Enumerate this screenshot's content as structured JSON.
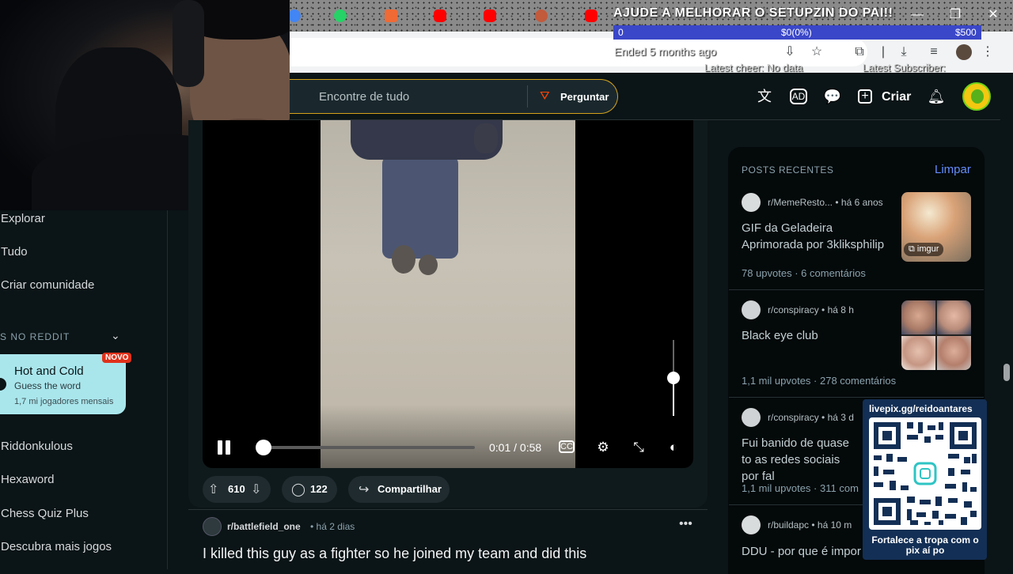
{
  "browser": {
    "tab_icons": [
      "chrome-icon",
      "whatsapp-icon",
      "bookmark-icon",
      "youtube-icon",
      "youtube-icon",
      "image-icon",
      "youtube-icon",
      "close-icon"
    ],
    "toolbar_icons": [
      "install-icon",
      "star-icon",
      "extensions-icon",
      "downloads-icon",
      "playlist-icon",
      "profile-icon",
      "more-icon"
    ],
    "window_controls": [
      "minimize-icon",
      "maximize-icon",
      "close-icon"
    ]
  },
  "overlay": {
    "title": "AJUDE A MELHORAR O SETUPZIN DO PAI!!",
    "goal_start": "0",
    "goal_current": "$0(0%)",
    "goal_target": "$500",
    "ended": "Ended 5 months ago",
    "latest_cheer": "Latest cheer: No data",
    "latest_subscriber": "Latest Subscriber:"
  },
  "header": {
    "search_placeholder": "Encontre de tudo",
    "ask_label": "Perguntar",
    "create_label": "Criar"
  },
  "sidebar": {
    "items": [
      "Explorar",
      "Tudo",
      "Criar comunidade"
    ],
    "section_heading": "S NO REDDIT",
    "game_card": {
      "title": "Hot and Cold",
      "subtitle": "Guess the word",
      "users": "1,7 mi jogadores mensais",
      "badge": "NOVO"
    },
    "games": [
      "Riddonkulous",
      "Hexaword",
      "Chess Quiz Plus",
      "Descubra mais jogos"
    ]
  },
  "video": {
    "time": "0:01 / 0:58",
    "progress": 0.02,
    "volume": 0.5
  },
  "post_actions": {
    "votes": "610",
    "comments": "122",
    "share_label": "Compartilhar"
  },
  "next_post": {
    "subreddit": "r/battlefield_one",
    "time": "há 2 dias",
    "title": "I killed this guy as a fighter so he joined my team and did this"
  },
  "recent_posts": {
    "heading": "POSTS RECENTES",
    "clear_label": "Limpar",
    "thumb_badge": "imgur",
    "items": [
      {
        "subreddit": "r/MemeResto...",
        "time": "há 6 anos",
        "title": "GIF da Geladeira Aprimorada por 3kliksphilip",
        "upvotes": "78 upvotes",
        "comments": "6 comentários"
      },
      {
        "subreddit": "r/conspiracy",
        "time": "há 8 h",
        "title": "Black eye club",
        "upvotes": "1,1 mil upvotes",
        "comments": "278 comentários"
      },
      {
        "subreddit": "r/conspiracy",
        "time": "há 3 d",
        "title": "Fui banido de quase to as redes sociais por fal",
        "upvotes": "1,1 mil upvotes",
        "comments": "311 com"
      },
      {
        "subreddit": "r/buildapc",
        "time": "há 10 m",
        "title": "DDU - por que é impor",
        "upvotes": "",
        "comments": ""
      }
    ]
  },
  "qr": {
    "url": "livepix.gg/reidoantares",
    "caption": "Fortalece a tropa com o pix aí po"
  }
}
